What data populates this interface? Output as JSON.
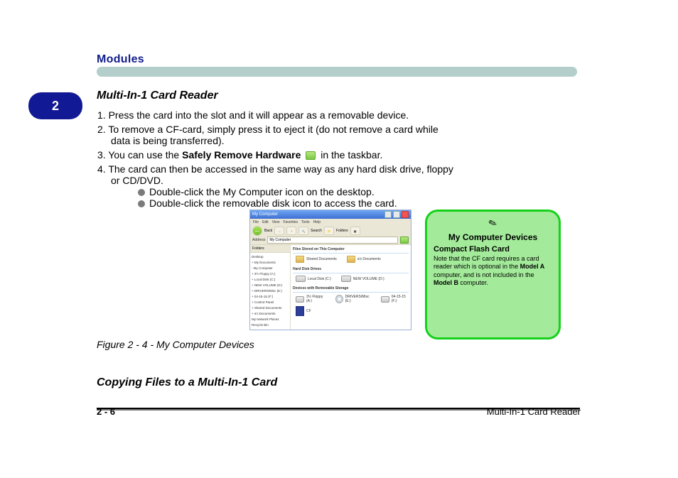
{
  "header": "Modules",
  "pill": "2",
  "section_title": "Multi-In-1 Card Reader",
  "steps": {
    "s1": "1. Press the card into the slot and it will appear as a removable device.",
    "s2": "2. To remove a CF-card, simply press it to eject it (do not remove a card while",
    "s2b": "data is being transferred).",
    "s3_prefix": "3. You can use the",
    "s3_link": " Safely Remove Hardware",
    "s3_icon": "icon",
    "s3_suffix": " in the taskbar.",
    "s4": "4. The card can then be accessed in the same way as any hard disk drive, floppy",
    "s4b": "or CD/DVD.",
    "s4_d1": "Double-click the My Computer icon on the desktop.",
    "s4_d2": "Double-click the removable disk icon to access the card."
  },
  "screenshot": {
    "window_title": "My Computer",
    "menus": [
      "File",
      "Edit",
      "View",
      "Favorites",
      "Tools",
      "Help"
    ],
    "toolbar": {
      "back": "Back",
      "search": "Search",
      "folders": "Folders"
    },
    "addr_label": "Address",
    "addr_value": "My Computer",
    "go": "Go",
    "side_header": "Folders",
    "tree_items": [
      "Desktop",
      "+ My Documents",
      "- My Computer",
      "  + 3½ Floppy (A:)",
      "  + Local Disk (C:)",
      "  + NEW VOLUME (D:)",
      "  + DRIVERS/Misc (E:)",
      "  + 04-15-15 (F:)",
      "  + Control Panel",
      "  + Shared Documents",
      "  + a's Documents",
      "My Network Places",
      "Recycle Bin"
    ],
    "groups": {
      "files": {
        "name": "Files Stored on This Computer",
        "items": [
          "Shared Documents",
          "a's Documents"
        ]
      },
      "drives": {
        "name": "Hard Disk Drives",
        "items": [
          "Local Disk (C:)",
          "NEW VOLUME (D:)"
        ]
      },
      "removable": {
        "name": "Devices with Removable Storage",
        "items": [
          "3½ Floppy (A:)",
          "DRIVERS/Misc (E:)",
          "04-15-15 (F:)",
          "CF"
        ]
      }
    }
  },
  "note": {
    "title": "My Computer Devices",
    "sub": "Compact Flash Card",
    "p1_a": "Note that the CF card requires a card reader which is optional in the ",
    "p1_model_a": "Model A",
    "p1_b": " computer, and is not included in the ",
    "p1_model_b": "Model B",
    "p1_c": " computer."
  },
  "figure_label": "Figure 2 - 4",
  "figure_title": " - My Computer Devices",
  "copy_heading": "Copying Files to a Multi-In-1 Card",
  "footer_page": "2 - 6",
  "footer_text": "Multi-In-1 Card Reader"
}
